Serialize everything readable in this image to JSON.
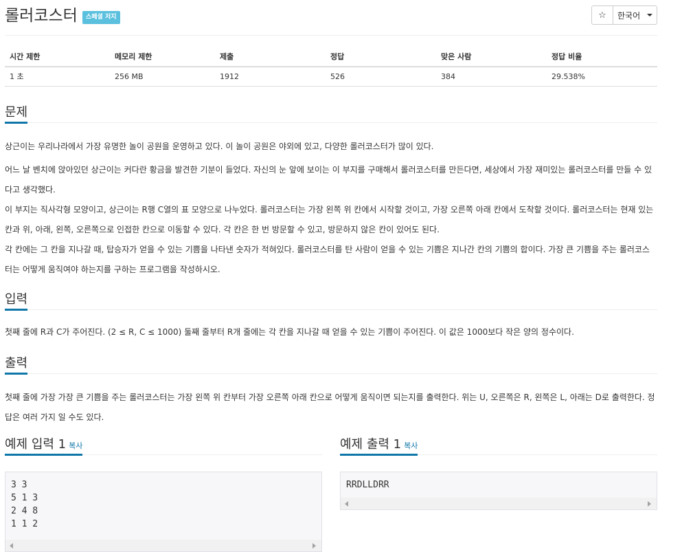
{
  "problem": {
    "title": "롤러코스터",
    "badge": "스페셜 저지",
    "star": "☆",
    "language": "한국어"
  },
  "info_table": {
    "headers": [
      "시간 제한",
      "메모리 제한",
      "제출",
      "정답",
      "맞은 사람",
      "정답 비율"
    ],
    "values": [
      "1 초",
      "256 MB",
      "1912",
      "526",
      "384",
      "29.538%"
    ]
  },
  "sections": {
    "problem_title": "문제",
    "problem_paragraphs": [
      "상근이는 우리나라에서 가장 유명한 놀이 공원을 운영하고 있다. 이 놀이 공원은 야외에 있고, 다양한 롤러코스터가 많이 있다.",
      "어느 날 벤치에 앉아있던 상근이는 커다란 황금을 발견한 기분이 들었다. 자신의 눈 앞에 보이는 이 부지를 구매해서 롤러코스터를 만든다면, 세상에서 가장 재미있는 롤러코스터를 만들 수 있다고 생각했다.",
      "이 부지는 직사각형 모양이고, 상근이는 R행 C열의 표 모양으로 나누었다. 롤러코스터는 가장 왼쪽 위 칸에서 시작할 것이고, 가장 오른쪽 아래 칸에서 도착할 것이다. 롤러코스터는 현재 있는 칸과 위, 아래, 왼쪽, 오른쪽으로 인접한 칸으로 이동할 수 있다. 각 칸은 한 번 방문할 수 있고, 방문하지 않은 칸이 있어도 된다.",
      "각 칸에는 그 칸을 지나갈 때, 탑승자가 얻을 수 있는 기쁨을 나타낸 숫자가 적혀있다. 롤러코스터를 탄 사람이 얻을 수 있는 기쁨은 지나간 칸의 기쁨의 합이다. 가장 큰 기쁨을 주는 롤러코스터는 어떻게 움직여야 하는지를 구하는 프로그램을 작성하시오."
    ],
    "input_title": "입력",
    "input_text": "첫째 줄에 R과 C가 주어진다. (2 ≤ R, C ≤ 1000) 둘째 줄부터 R개 줄에는 각 칸을 지나갈 때 얻을 수 있는 기쁨이 주어진다. 이 값은 1000보다 작은 양의 정수이다.",
    "output_title": "출력",
    "output_text": "첫째 줄에 가장 가장 큰 기쁨을 주는 롤러코스터는 가장 왼쪽 위 칸부터 가장 오른쪽 아래 칸으로 어떻게 움직이면 되는지를 출력한다. 위는 U, 오른쪽은 R, 왼쪽은 L, 아래는 D로 출력한다. 정답은 여러 가지 일 수도 있다."
  },
  "samples": {
    "input_title": "예제 입력 1",
    "output_title": "예제 출력 1",
    "copy_label": "복사",
    "input": "3 3\n5 1 3\n2 4 8\n1 1 2",
    "output": "RRDLLDRR"
  },
  "colors": {
    "accent": "#0e76a8",
    "badge": "#5bc0de"
  }
}
